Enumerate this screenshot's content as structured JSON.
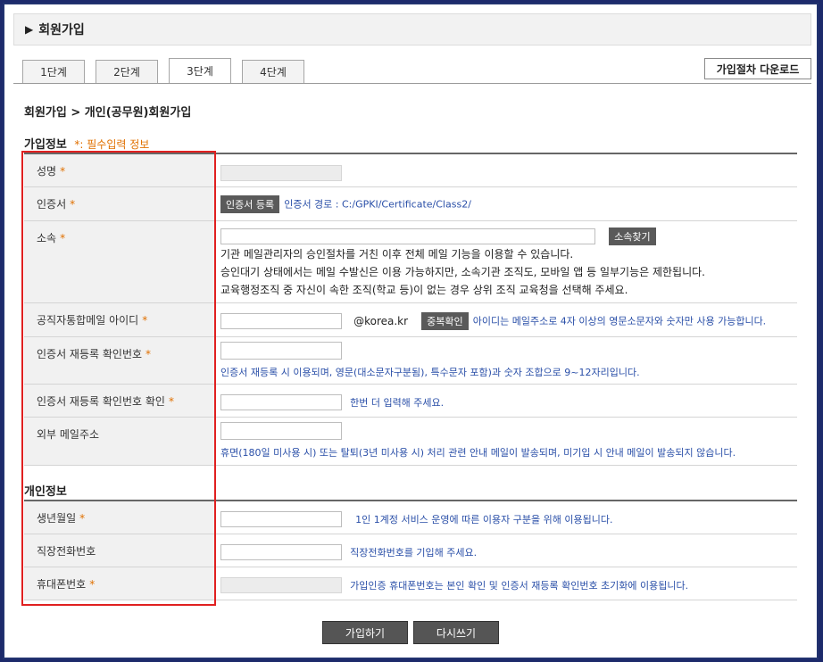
{
  "header": {
    "title": "회원가입"
  },
  "tabs": [
    {
      "label": "1단계",
      "active": false
    },
    {
      "label": "2단계",
      "active": false
    },
    {
      "label": "3단계",
      "active": true
    },
    {
      "label": "4단계",
      "active": false
    }
  ],
  "download_button": "가입절차 다운로드",
  "breadcrumb": "회원가입 > 개인(공무원)회원가입",
  "signup_section": {
    "title": "가입정보",
    "required_mark": "*",
    "required_note": ": 필수입력 정보"
  },
  "personal_section": {
    "title": "개인정보"
  },
  "required_mark": "*",
  "fields": {
    "name": {
      "label": "성명"
    },
    "cert": {
      "label": "인증서",
      "button": "인증서 등록",
      "path_text": "인증서 경로 : C:/GPKI/Certificate/Class2/"
    },
    "affiliation": {
      "label": "소속",
      "button": "소속찾기",
      "info": [
        "기관 메일관리자의 승인절차를 거친 이후 전체 메일 기능을 이용할 수 있습니다.",
        "승인대기 상태에서는 메일 수발신은 이용 가능하지만, 소속기관 조직도, 모바일 앱 등 일부기능은 제한됩니다.",
        "교육행정조직 중 자신이 속한 조직(학교 등)이 없는 경우 상위 조직 교육청을 선택해 주세요."
      ]
    },
    "mail_id": {
      "label": "공직자통합메일 아이디",
      "domain": "@korea.kr",
      "button": "중복확인",
      "hint": "아이디는 메일주소로 4자 이상의 영문소문자와 숫자만 사용 가능합니다."
    },
    "cert_pw": {
      "label": "인증서 재등록 확인번호",
      "hint": "인증서 재등록 시 이용되며, 영문(대소문자구분됨), 특수문자 포함)과 숫자 조합으로 9~12자리입니다."
    },
    "cert_pw_confirm": {
      "label": "인증서 재등록 확인번호 확인",
      "hint": "한번 더 입력해 주세요."
    },
    "external_mail": {
      "label": "외부 메일주소",
      "hint": "휴면(180일 미사용 시) 또는 탈퇴(3년 미사용 시) 처리 관련 안내 메일이 발송되며, 미기입 시 안내 메일이 발송되지 않습니다."
    },
    "birth": {
      "label": "생년월일",
      "hint": "1인 1계정 서비스 운영에 따른 이용자 구분을 위해 이용됩니다."
    },
    "office_phone": {
      "label": "직장전화번호",
      "hint": "직장전화번호를 기입해 주세요."
    },
    "mobile": {
      "label": "휴대폰번호",
      "hint": "가입인증 휴대폰번호는 본인 확인 및 인증서 재등록 확인번호 초기화에 이용됩니다."
    }
  },
  "actions": {
    "submit": "가입하기",
    "reset": "다시쓰기"
  },
  "colors": {
    "accent": "#e07000",
    "hint": "#2a4fa8",
    "highlight_box": "#e02020"
  }
}
